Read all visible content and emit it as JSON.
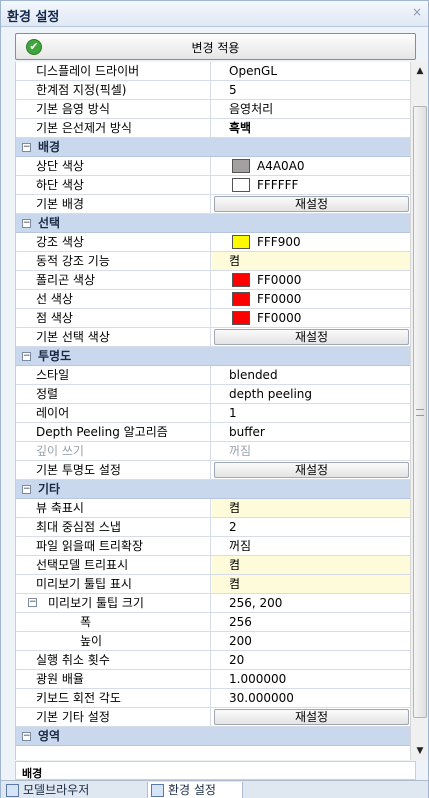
{
  "window": {
    "title": "환경 설정",
    "close": "×"
  },
  "apply_button": {
    "label": "변경 적용",
    "icon": "check-circle-icon"
  },
  "grid": {
    "rows": [
      {
        "type": "prop",
        "name": "디스플레이 드라이버",
        "value": "OpenGL"
      },
      {
        "type": "prop",
        "name": "한계점 지정(픽셀)",
        "value": "5"
      },
      {
        "type": "prop",
        "name": "기본 음영 방식",
        "value": "음영처리"
      },
      {
        "type": "prop",
        "name": "기본 은선제거 방식",
        "value": "흑백",
        "bold": true
      },
      {
        "type": "cat",
        "name": "배경"
      },
      {
        "type": "color",
        "name": "상단 색상",
        "value": "A4A0A0",
        "color": "#A4A0A0"
      },
      {
        "type": "color",
        "name": "하단 색상",
        "value": "FFFFFF",
        "color": "#FFFFFF"
      },
      {
        "type": "reset",
        "name": "기본 배경",
        "value": "재설정"
      },
      {
        "type": "cat",
        "name": "선택"
      },
      {
        "type": "color",
        "name": "강조 색상",
        "value": "FFF900",
        "color": "#FFF900"
      },
      {
        "type": "prop",
        "name": "동적 강조 기능",
        "value": "켬",
        "highlight": true
      },
      {
        "type": "color",
        "name": "폴리곤 색상",
        "value": "FF0000",
        "color": "#FF0000"
      },
      {
        "type": "color",
        "name": "선 색상",
        "value": "FF0000",
        "color": "#FF0000"
      },
      {
        "type": "color",
        "name": "점 색상",
        "value": "FF0000",
        "color": "#FF0000"
      },
      {
        "type": "reset",
        "name": "기본 선택 색상",
        "value": "재설정"
      },
      {
        "type": "cat",
        "name": "투명도"
      },
      {
        "type": "prop",
        "name": "스타일",
        "value": "blended"
      },
      {
        "type": "prop",
        "name": "정렬",
        "value": "depth peeling"
      },
      {
        "type": "prop",
        "name": "레이어",
        "value": "1"
      },
      {
        "type": "prop",
        "name": "Depth Peeling 알고리즘",
        "value": "buffer"
      },
      {
        "type": "prop",
        "name": "깊이 쓰기",
        "value": "꺼짐",
        "disabled": true
      },
      {
        "type": "reset",
        "name": "기본 투명도 설정",
        "value": "재설정"
      },
      {
        "type": "cat",
        "name": "기타"
      },
      {
        "type": "prop",
        "name": "뷰 축표시",
        "value": "켬",
        "highlight": true
      },
      {
        "type": "prop",
        "name": "최대 중심점 스냅",
        "value": "2"
      },
      {
        "type": "prop",
        "name": "파일 읽을때 트리확장",
        "value": "꺼짐"
      },
      {
        "type": "prop",
        "name": "선택모델 트리표시",
        "value": "켬",
        "highlight": true
      },
      {
        "type": "prop",
        "name": "미리보기 툴팁 표시",
        "value": "켬",
        "highlight": true
      },
      {
        "type": "group",
        "name": "미리보기 툴팁 크기",
        "value": "256, 200"
      },
      {
        "type": "sub",
        "name": "폭",
        "value": "256"
      },
      {
        "type": "sub",
        "name": "높이",
        "value": "200"
      },
      {
        "type": "prop",
        "name": "실행 취소 횟수",
        "value": "20"
      },
      {
        "type": "prop",
        "name": "광원 배율",
        "value": "1.000000"
      },
      {
        "type": "prop",
        "name": "키보드 회전 각도",
        "value": "30.000000"
      },
      {
        "type": "reset",
        "name": "기본 기타 설정",
        "value": "재설정"
      },
      {
        "type": "cat",
        "name": "영역"
      }
    ]
  },
  "description": {
    "title": "배경"
  },
  "tabs": [
    {
      "label": "모델브라우저",
      "icon": "model-browser-icon"
    },
    {
      "label": "환경 설정",
      "icon": "settings-icon"
    }
  ]
}
